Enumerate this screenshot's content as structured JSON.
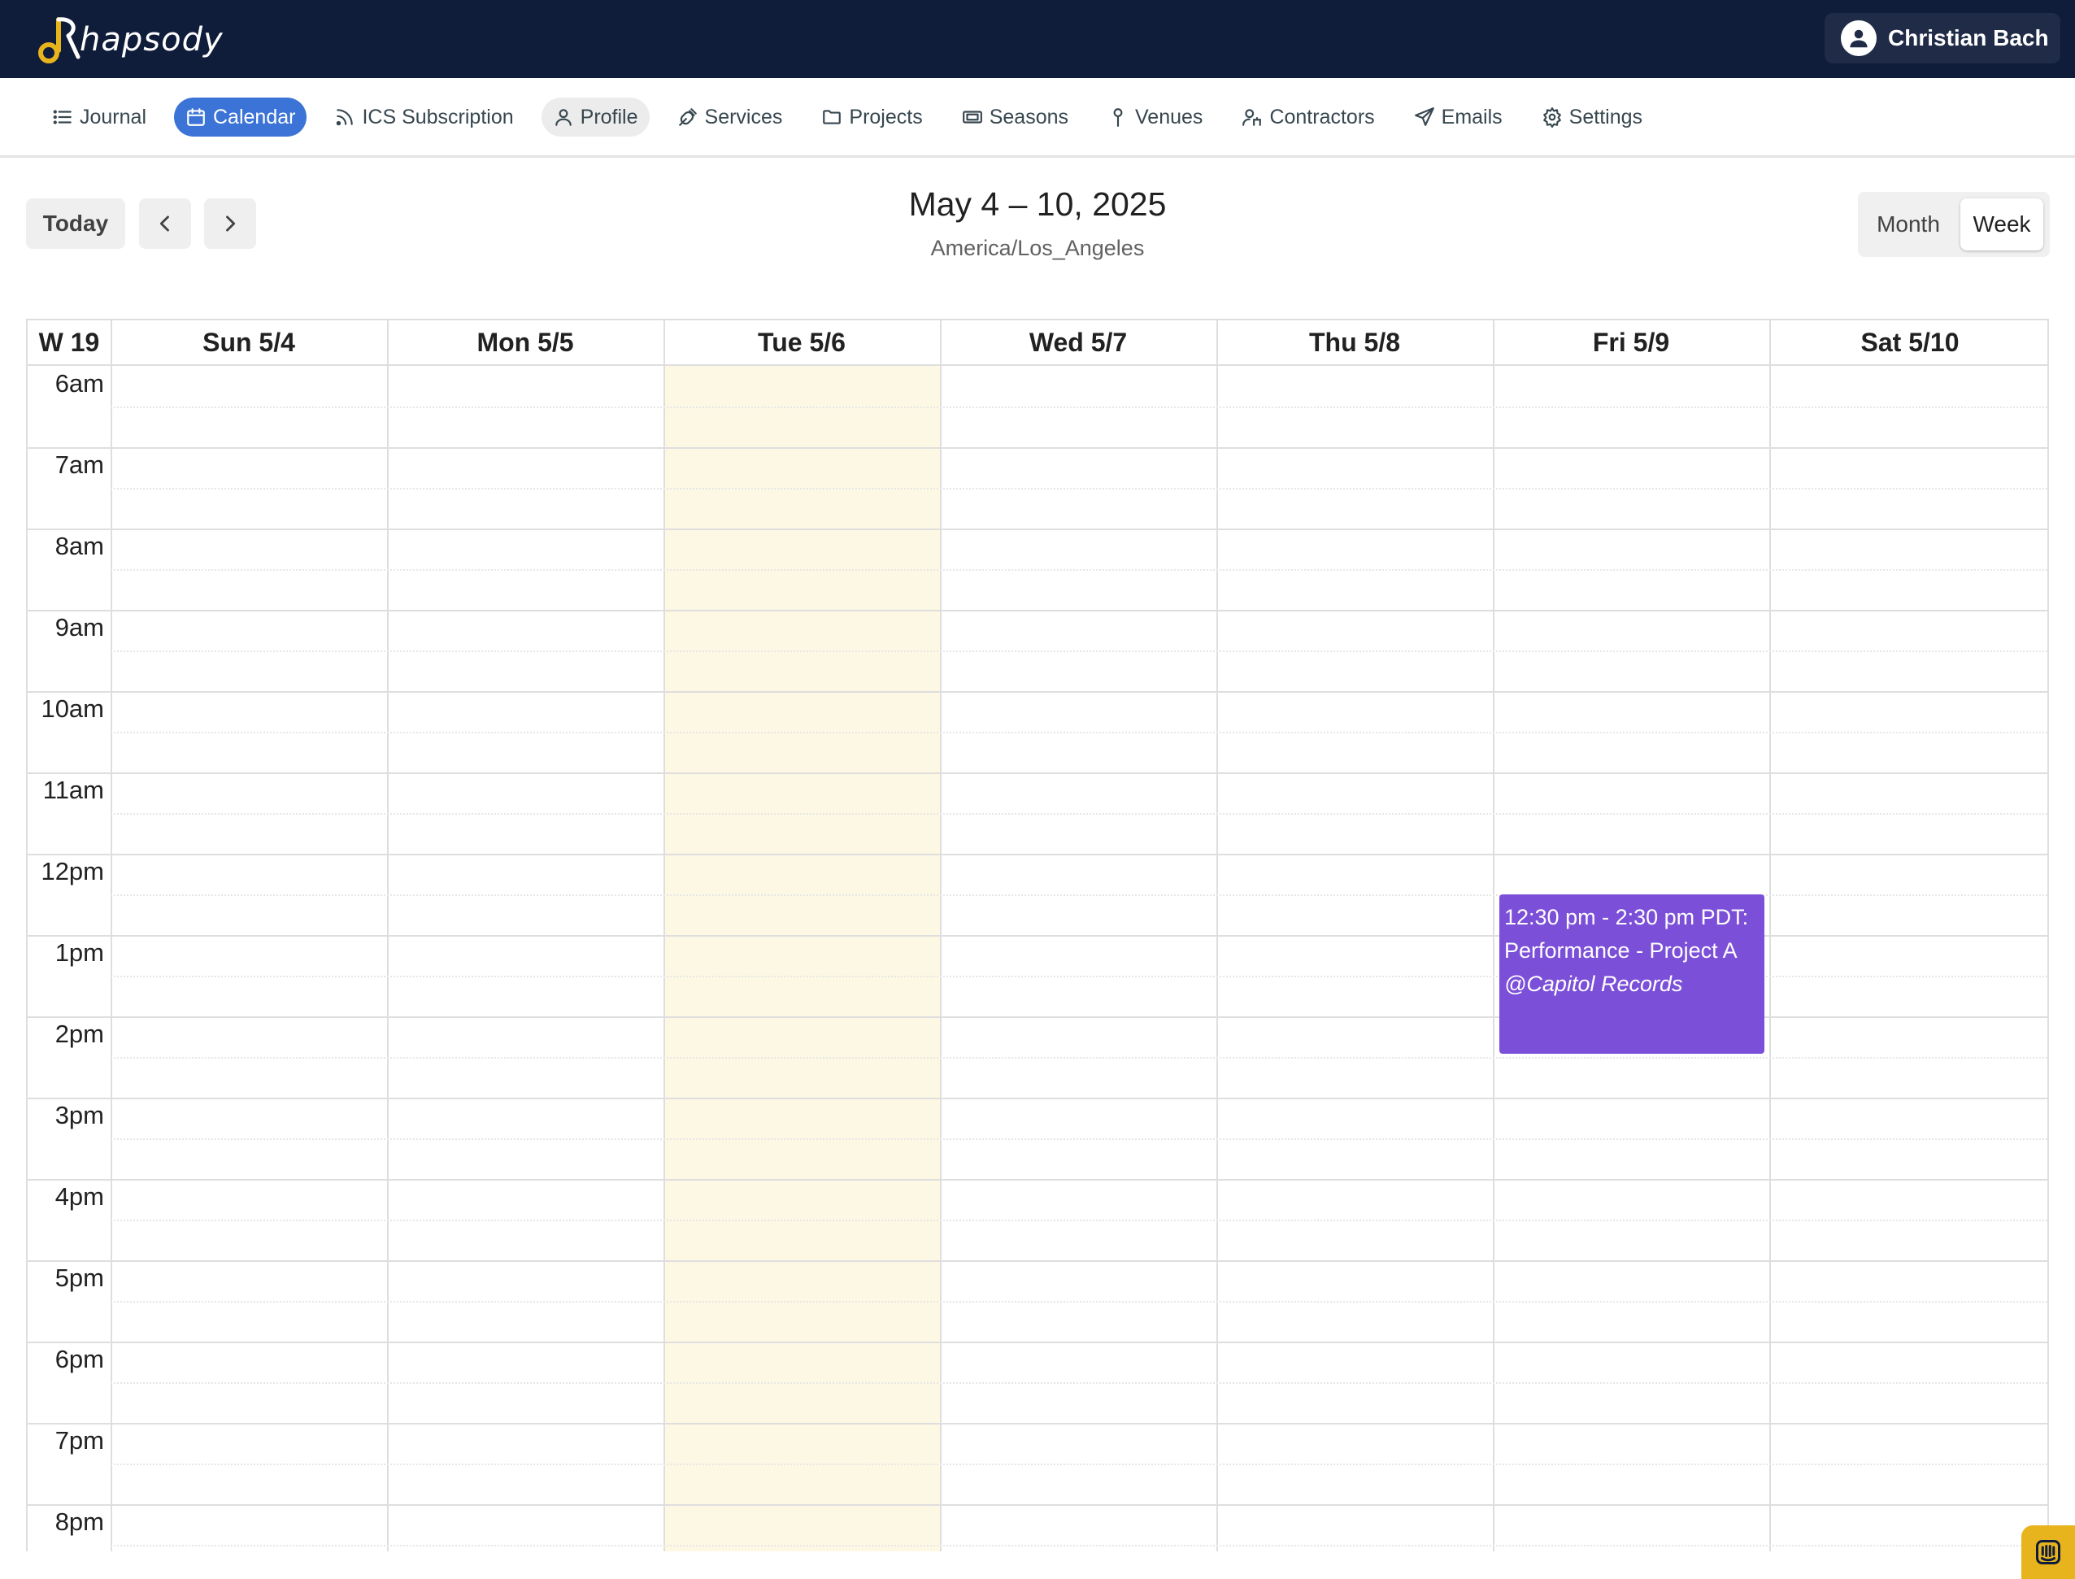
{
  "brand": {
    "name": "hapsody",
    "logo_icon": "rhapsody-logo-icon",
    "logo_color": "#e8b41d"
  },
  "user": {
    "name": "Christian Bach",
    "icon": "user-icon"
  },
  "nav": {
    "items": [
      {
        "label": "Journal",
        "icon": "list-icon"
      },
      {
        "label": "Calendar",
        "icon": "calendar-icon"
      },
      {
        "label": "ICS Subscription",
        "icon": "rss-icon"
      },
      {
        "label": "Profile",
        "icon": "user-outline-icon"
      },
      {
        "label": "Services",
        "icon": "violin-icon"
      },
      {
        "label": "Projects",
        "icon": "folder-icon"
      },
      {
        "label": "Seasons",
        "icon": "ticket-icon"
      },
      {
        "label": "Venues",
        "icon": "map-pin-icon"
      },
      {
        "label": "Contractors",
        "icon": "contractor-icon"
      },
      {
        "label": "Emails",
        "icon": "send-icon"
      },
      {
        "label": "Settings",
        "icon": "gear-icon"
      }
    ],
    "active": "Calendar",
    "active_color": "#3b74d6"
  },
  "toolbar": {
    "today_label": "Today",
    "prev_icon": "chevron-left-icon",
    "next_icon": "chevron-right-icon",
    "range_title": "May 4 – 10, 2025",
    "timezone": "America/Los_Angeles",
    "views": [
      "Month",
      "Week"
    ],
    "active_view": "Week"
  },
  "calendar": {
    "week_label": "W 19",
    "days": [
      "Sun 5/4",
      "Mon 5/5",
      "Tue 5/6",
      "Wed 5/7",
      "Thu 5/8",
      "Fri 5/9",
      "Sat 5/10"
    ],
    "today": "Tue 5/6",
    "today_color": "#fdf8e4",
    "hours": [
      "6am",
      "7am",
      "8am",
      "9am",
      "10am",
      "11am",
      "12pm",
      "1pm",
      "2pm",
      "3pm",
      "4pm",
      "5pm",
      "6pm",
      "7pm",
      "8pm"
    ],
    "events": [
      {
        "day": "Fri 5/9",
        "time": "12:30 pm - 2:30 pm PDT:",
        "title": "Performance - Project A",
        "venue": "@Capitol Records",
        "color": "#7b4fd8"
      }
    ]
  },
  "chat_widget": {
    "icon": "chat-icon",
    "color": "#e8b41d"
  }
}
